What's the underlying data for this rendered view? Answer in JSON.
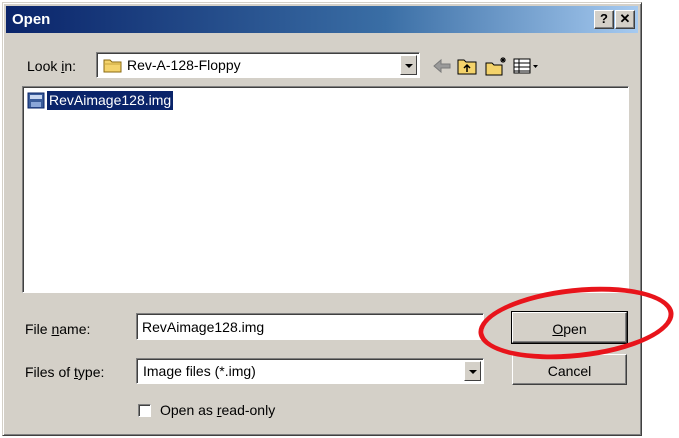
{
  "window": {
    "title": "Open",
    "help_label": "?",
    "close_label": "✕"
  },
  "look_in": {
    "label": "Look in:",
    "value": "Rev-A-128-Floppy"
  },
  "toolbar": {
    "back_icon": "back-arrow-icon",
    "up_icon": "up-folder-icon",
    "new_folder_icon": "new-folder-icon",
    "view_menu_icon": "view-menu-icon"
  },
  "files": [
    {
      "name": "RevAimage128.img",
      "icon": "disk-image-icon",
      "selected": true
    }
  ],
  "file_name": {
    "label": "File name:",
    "value": "RevAimage128.img"
  },
  "files_of_type": {
    "label": "Files of type:",
    "value": "Image files (*.img)"
  },
  "buttons": {
    "open": "Open",
    "cancel": "Cancel"
  },
  "read_only": {
    "label": "Open as read-only",
    "checked": false
  },
  "colors": {
    "title_bar": "#0a246a",
    "face": "#d4d0c8",
    "selection": "#0a246a",
    "annotation": "#e8141b"
  }
}
